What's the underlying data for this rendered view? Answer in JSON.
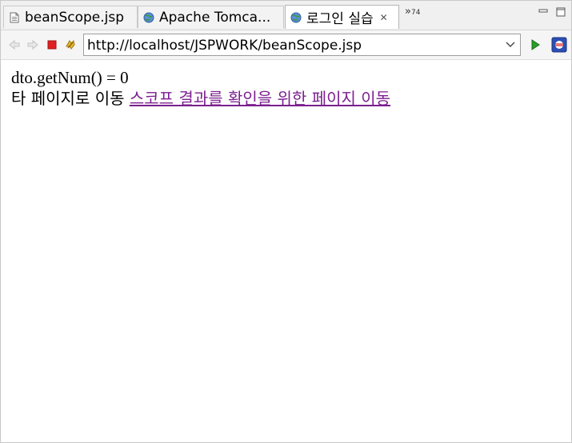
{
  "tabs": [
    {
      "label": "beanScope.jsp",
      "icon": "jsp-file-icon",
      "active": false
    },
    {
      "label": "Apache Tomca...",
      "icon": "globe-icon",
      "active": false
    },
    {
      "label": "로그인 실습",
      "icon": "globe-icon",
      "active": true
    }
  ],
  "tab_overflow": {
    "symbol": "»",
    "count": "74"
  },
  "toolbar": {
    "url": "http://localhost/JSPWORK/beanScope.jsp"
  },
  "content": {
    "line1": "dto.getNum() = 0",
    "line2_prefix": "타 페이지로 이동 ",
    "link_text": "스코프 결과를 확인을 위한 페이지 이동"
  },
  "colors": {
    "link": "#7b1f8f",
    "stop_red": "#e02020",
    "go_green": "#2a9d2a"
  }
}
